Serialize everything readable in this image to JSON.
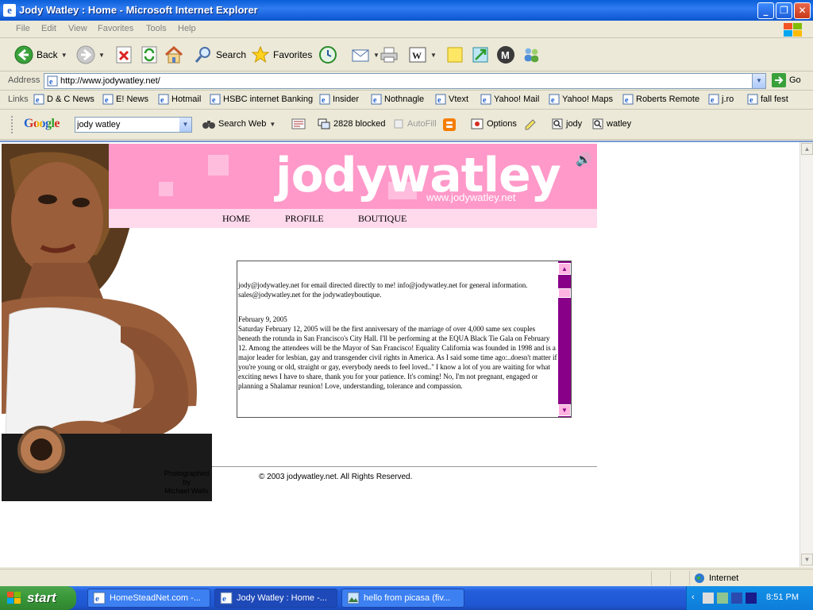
{
  "window": {
    "title": "Jody Watley : Home - Microsoft Internet Explorer",
    "minimize": "_",
    "maximize": "❐",
    "close": "✕"
  },
  "menu": [
    "File",
    "Edit",
    "View",
    "Favorites",
    "Tools",
    "Help"
  ],
  "toolbar": {
    "back": "Back",
    "search": "Search",
    "favorites": "Favorites"
  },
  "address": {
    "label": "Address",
    "url": "http://www.jodywatley.net/",
    "go": "Go"
  },
  "links": {
    "label": "Links",
    "items": [
      "D & C News",
      "E! News",
      "Hotmail",
      "HSBC internet Banking",
      "Insider",
      "Nothnagle",
      "Vtext",
      "Yahoo! Mail",
      "Yahoo! Maps",
      "Roberts Remote",
      "j.ro",
      "fall fest"
    ]
  },
  "google_bar": {
    "logo": "Google",
    "query": "jody watley",
    "search_web": "Search Web",
    "blocked": "2828 blocked",
    "autofill": "AutoFill",
    "options": "Options",
    "word1": "jody",
    "word2": "watley"
  },
  "site": {
    "brand": "jodywatley",
    "brand_url": "www.jodywatley.net",
    "nav": [
      "HOME",
      "PROFILE",
      "BOUTIQUE"
    ],
    "news": {
      "contact": "jody@jodywatley.net for email directed directly to me! info@jodywatley.net for general information. sales@jodywatley.net for the jodywatleyboutique.",
      "date": "February 9, 2005",
      "body": "Saturday February 12, 2005 will be the first anniversary of the marriage of over 4,000 same sex couples beneath the rotunda in San Francisco's City Hall. I'll be performing at the EQUA Black Tie Gala on February 12. Among the attendees will be the Mayor of San Francisco! Equality California was founded in 1998 and is a major leader for lesbian, gay and transgender civil rights in America. As I said some time ago:..doesn't matter if you're young or old, straight or gay, everybody needs to feel loved..\" I know a lot of you are waiting for what exciting news I have to share, thank you for your patience. It's coming! No, I'm not pregnant, engaged or planning a Shalamar reunion! Love, understanding, tolerance and compassion."
    },
    "credit": [
      "Photographed",
      "by",
      "Michael Walls"
    ],
    "copyright": "© 2003 jodywatley.net. All Rights Reserved."
  },
  "status": {
    "zone": "Internet"
  },
  "taskbar": {
    "start": "start",
    "tasks": [
      "HomeSteadNet.com -...",
      "Jody Watley : Home -...",
      "hello from picasa (fiv..."
    ],
    "clock": "8:51 PM"
  },
  "colors": {
    "banner_pink": "#ff99c9",
    "nav_pink": "#ffd9ec",
    "news_scrollbar": "#880088",
    "xp_blue": "#245edb"
  }
}
